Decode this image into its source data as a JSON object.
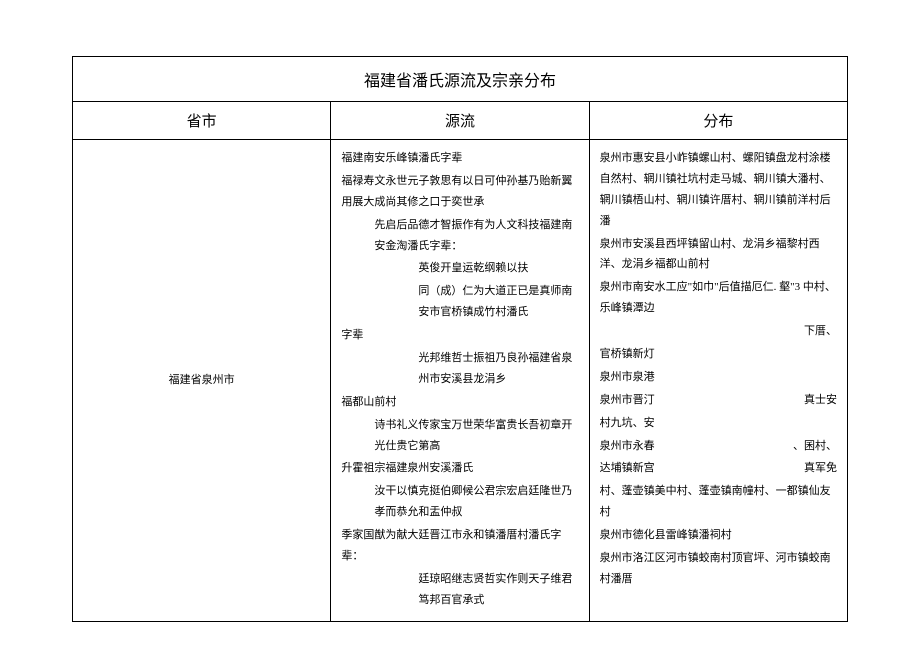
{
  "title": "福建省潘氏源流及宗亲分布",
  "headers": {
    "province": "省市",
    "origin": "源流",
    "distribution": "分布"
  },
  "row": {
    "province": "福建省泉州市",
    "origin_lines": [
      {
        "text": "福建南安乐峰镇潘氏字辈"
      },
      {
        "text": "福禄寿文永世元子敦思有以日可仲孙基乃贻新翼用展大成尚其修之口于奕世承"
      },
      {
        "text": "先启后品德才智振作有为人文科技福建南安金淘潘氏字辈：",
        "cls": "indent1"
      },
      {
        "text": "英俊开皇运乾纲赖以扶",
        "cls": "indent2"
      },
      {
        "text": "同（成）仁为大道正已是真师南安市官桥镇成竹村潘氏",
        "cls": "indent2"
      },
      {
        "text": "字辈"
      },
      {
        "text": "光邦维哲士振祖乃良孙福建省泉州市安溪县龙涓乡",
        "cls": "indent2"
      },
      {
        "text": "福都山前村"
      },
      {
        "text": "诗书礼义传家宝万世荣华富贵长吾初章开光仕贵它第高",
        "cls": "indent1"
      },
      {
        "text": "升霍祖宗福建泉州安溪潘氏"
      },
      {
        "text": "汝干以慎克挺伯卿候公君宗宏启廷隆世乃孝而恭允和盂仲叔",
        "cls": "indent1"
      },
      {
        "text": "季家国猷为献大廷晋江市永和镇潘厝村潘氏字辈："
      },
      {
        "text": "廷琼昭继志贤哲实作则天子维君笃邦百官承式",
        "cls": "indent2"
      }
    ],
    "distribution_lines": [
      {
        "text": "泉州市惠安县小岞镇螺山村、螺阳镇盘龙村涂楼自然村、辋川镇社坑村走马城、辋川镇大潘村、辋川镇梧山村、辋川镇许厝村、辋川镇前洋村后潘"
      },
      {
        "text": "泉州市安溪县西坪镇留山村、龙涓乡福黎村西洋、龙涓乡福都山前村"
      },
      {
        "text": "泉州市南安水工应\"如巾\"后值描厄仁. 壑\"3 中村、乐峰镇潭边"
      },
      {
        "text": "下厝、",
        "cls": "right-align"
      },
      {
        "text": "官桥镇新灯"
      },
      {
        "text": "泉州市泉港"
      },
      {
        "left": "泉州市晋汀",
        "right": "真士安"
      },
      {
        "text": "村九坑、安"
      },
      {
        "left": "泉州市永春",
        "right": "、囷村、"
      },
      {
        "left": "达埔镇新宫",
        "right": "真军免"
      },
      {
        "text": "村、蓬壶镇美中村、蓬壶镇南幢村、一都镇仙友村"
      },
      {
        "text": "泉州市德化县雷峰镇潘祠村"
      },
      {
        "text": "泉州市洛江区河市镇蛟南村顶官坪、河市镇蛟南村潘厝"
      }
    ]
  }
}
